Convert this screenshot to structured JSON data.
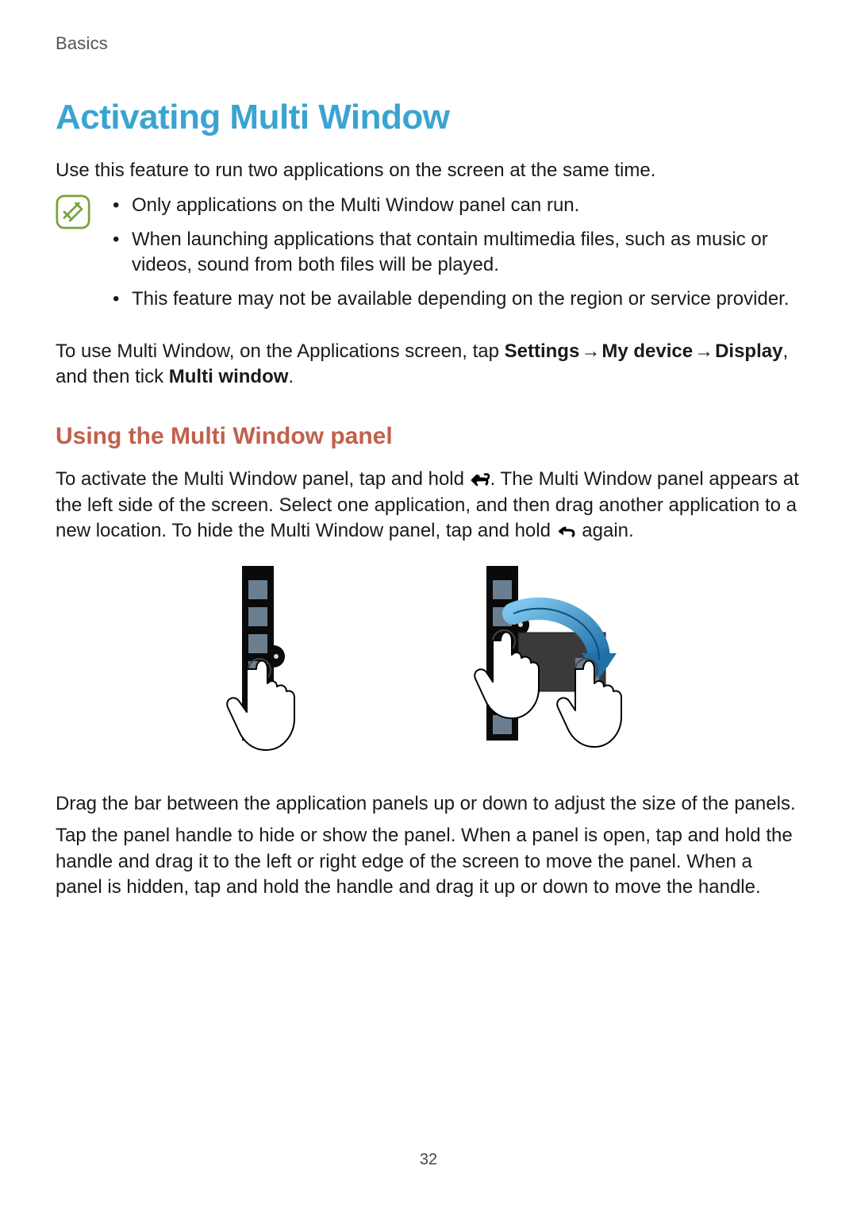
{
  "header": {
    "section": "Basics"
  },
  "title": "Activating Multi Window",
  "intro": "Use this feature to run two applications on the screen at the same time.",
  "notes": {
    "items": [
      "Only applications on the Multi Window panel can run.",
      "When launching applications that contain multimedia files, such as music or videos, sound from both files will be played.",
      "This feature may not be available depending on the region or service provider."
    ]
  },
  "enable": {
    "pre": "To use Multi Window, on the Applications screen, tap ",
    "settings": "Settings",
    "arrow": " → ",
    "mydevice": "My device",
    "display": "Display",
    "mid": ", and then tick ",
    "multiwindow": "Multi window",
    "post": "."
  },
  "subhead": "Using the Multi Window panel",
  "activate": {
    "pre": "To activate the Multi Window panel, tap and hold ",
    "mid": ". The Multi Window panel appears at the left side of the screen. Select one application, and then drag another application to a new location. To hide the Multi Window panel, tap and hold ",
    "post": " again."
  },
  "drag": "Drag the bar between the application panels up or down to adjust the size of the panels.",
  "handle": "Tap the panel handle to hide or show the panel. When a panel is open, tap and hold the handle and drag it to the left or right edge of the screen to move the panel. When a panel is hidden, tap and hold the handle and drag it up or down to move the handle.",
  "page_number": "32",
  "colors": {
    "title": "#3aa4d1",
    "subhead": "#c0614c",
    "note_icon": "#7aa23a",
    "drag_arrow": "#1f86c6"
  }
}
